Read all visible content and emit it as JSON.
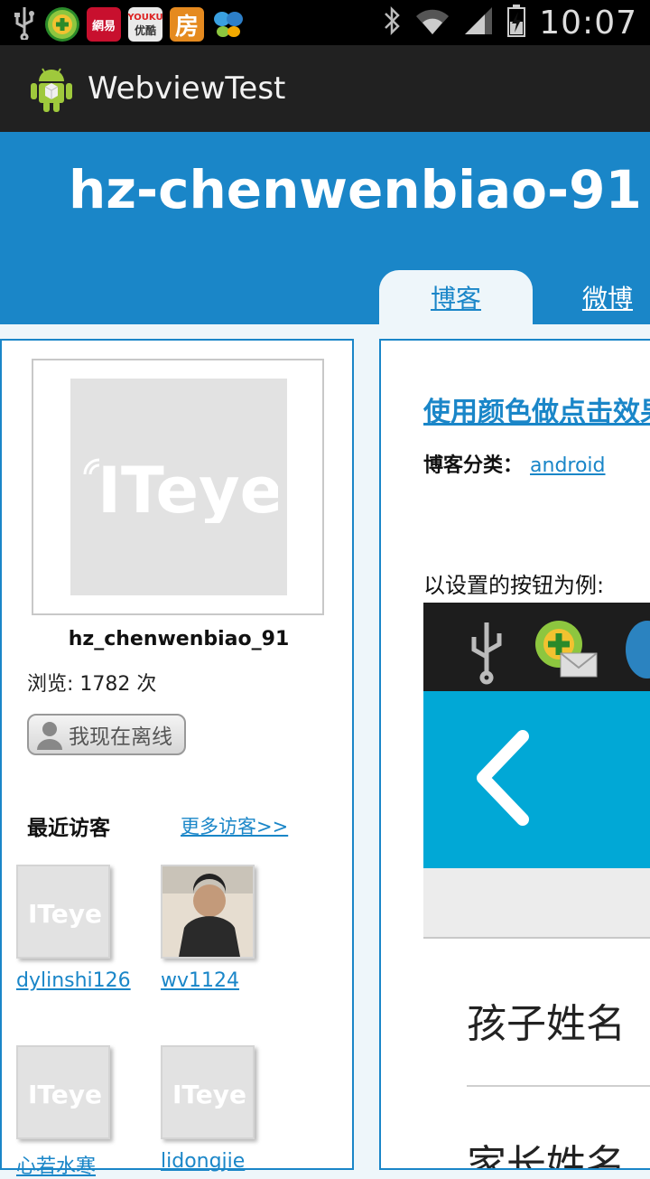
{
  "status_bar": {
    "time": "10:07",
    "notification_icons": [
      "usb-icon",
      "add-app-icon",
      "netease-icon",
      "youku-icon",
      "fang-icon",
      "butterfly-icon"
    ],
    "netease_label": "網易",
    "youku_label": "优酷",
    "fang_label": "房",
    "system_icons": [
      "bluetooth-icon",
      "wifi-icon",
      "signal-icon",
      "battery-charging-icon"
    ]
  },
  "action_bar": {
    "app_title": "WebviewTest",
    "app_icon": "android-icon"
  },
  "blog_header": {
    "title": "hz-chenwenbiao-91",
    "tabs": [
      {
        "label": "博客",
        "active": true
      },
      {
        "label": "微博",
        "active": false
      }
    ]
  },
  "profile": {
    "avatar_logo": "ITeye",
    "username": "hz_chenwenbiao_91",
    "views": "浏览: 1782 次",
    "status_badge": "我现在离线",
    "recent_visitors_title": "最近访客",
    "more_visitors": "更多访客>>",
    "visitors": [
      {
        "name": "dylinshi126",
        "avatar": "iteye-logo"
      },
      {
        "name": "wv1124",
        "avatar": "photo"
      },
      {
        "name": "心若水寒",
        "avatar": "iteye-logo"
      },
      {
        "name": "lidongjie",
        "avatar": "iteye-logo"
      }
    ]
  },
  "post": {
    "title": "使用颜色做点击效果",
    "category_label": "博客分类：",
    "category": "android",
    "intro": "以设置的按钮为例:",
    "embedded_rows": [
      "孩子姓名",
      "家长姓名"
    ]
  },
  "colors": {
    "header_blue": "#1a86c8",
    "page_bg": "#eef6fa",
    "embed_blue": "#01a8d6",
    "actionbar": "#212121"
  }
}
